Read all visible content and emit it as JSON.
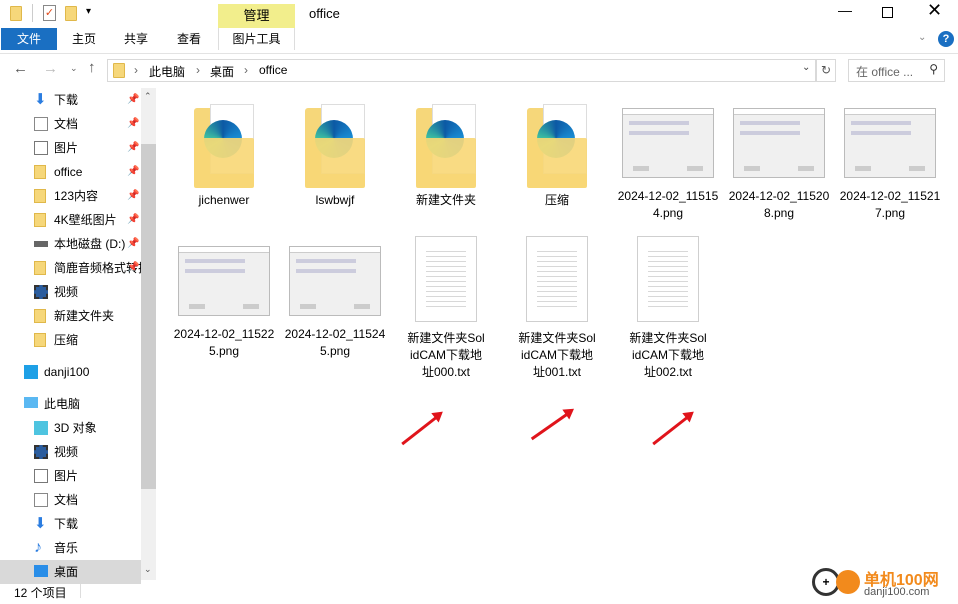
{
  "window": {
    "title": "office",
    "context_tab": "管理"
  },
  "ribbon": {
    "tabs": [
      "文件",
      "主页",
      "共享",
      "查看",
      "图片工具"
    ]
  },
  "address": {
    "crumbs": [
      "此电脑",
      "桌面",
      "office"
    ],
    "search_placeholder": "在 office ..."
  },
  "sidebar": {
    "quick": [
      {
        "label": "下载",
        "icon": "download-icon"
      },
      {
        "label": "文档",
        "icon": "document-icon"
      },
      {
        "label": "图片",
        "icon": "pictures-icon"
      },
      {
        "label": "office",
        "icon": "folder-icon"
      },
      {
        "label": "123内容",
        "icon": "folder-icon"
      },
      {
        "label": "4K壁纸图片",
        "icon": "folder-icon"
      },
      {
        "label": "本地磁盘 (D:)",
        "icon": "drive-icon"
      },
      {
        "label": "简鹿音频格式转换",
        "icon": "folder-icon"
      },
      {
        "label": "视频",
        "icon": "video-icon"
      },
      {
        "label": "新建文件夹",
        "icon": "folder-icon"
      },
      {
        "label": "压缩",
        "icon": "folder-icon"
      }
    ],
    "cloud": {
      "label": "danji100",
      "icon": "cloud-icon"
    },
    "pc": {
      "label": "此电脑",
      "icon": "computer-icon"
    },
    "pc_items": [
      {
        "label": "3D 对象",
        "icon": "3d-objects-icon"
      },
      {
        "label": "视频",
        "icon": "video-icon"
      },
      {
        "label": "图片",
        "icon": "pictures-icon"
      },
      {
        "label": "文档",
        "icon": "document-icon"
      },
      {
        "label": "下载",
        "icon": "download-icon"
      },
      {
        "label": "音乐",
        "icon": "music-icon"
      },
      {
        "label": "桌面",
        "icon": "desktop-icon",
        "selected": true
      }
    ]
  },
  "files": [
    {
      "name": "jichenwer",
      "type": "folder"
    },
    {
      "name": "lswbwjf",
      "type": "folder"
    },
    {
      "name": "新建文件夹",
      "type": "folder"
    },
    {
      "name": "压缩",
      "type": "folder"
    },
    {
      "name": "2024-12-02_115154.png",
      "type": "image"
    },
    {
      "name": "2024-12-02_115208.png",
      "type": "image"
    },
    {
      "name": "2024-12-02_115217.png",
      "type": "image"
    },
    {
      "name": "2024-12-02_115225.png",
      "type": "image"
    },
    {
      "name": "2024-12-02_115245.png",
      "type": "image"
    },
    {
      "name": "新建文件夹SolidCAM下载地址000.txt",
      "type": "text"
    },
    {
      "name": "新建文件夹SolidCAM下载地址001.txt",
      "type": "text"
    },
    {
      "name": "新建文件夹SolidCAM下载地址002.txt",
      "type": "text"
    }
  ],
  "status": {
    "count": "12 个项目"
  },
  "watermark": {
    "text": "单机100网",
    "url": "danji100.com"
  },
  "colors": {
    "accent": "#1a6fc2",
    "context": "#f2ee8c",
    "arrow": "#e0141b"
  }
}
